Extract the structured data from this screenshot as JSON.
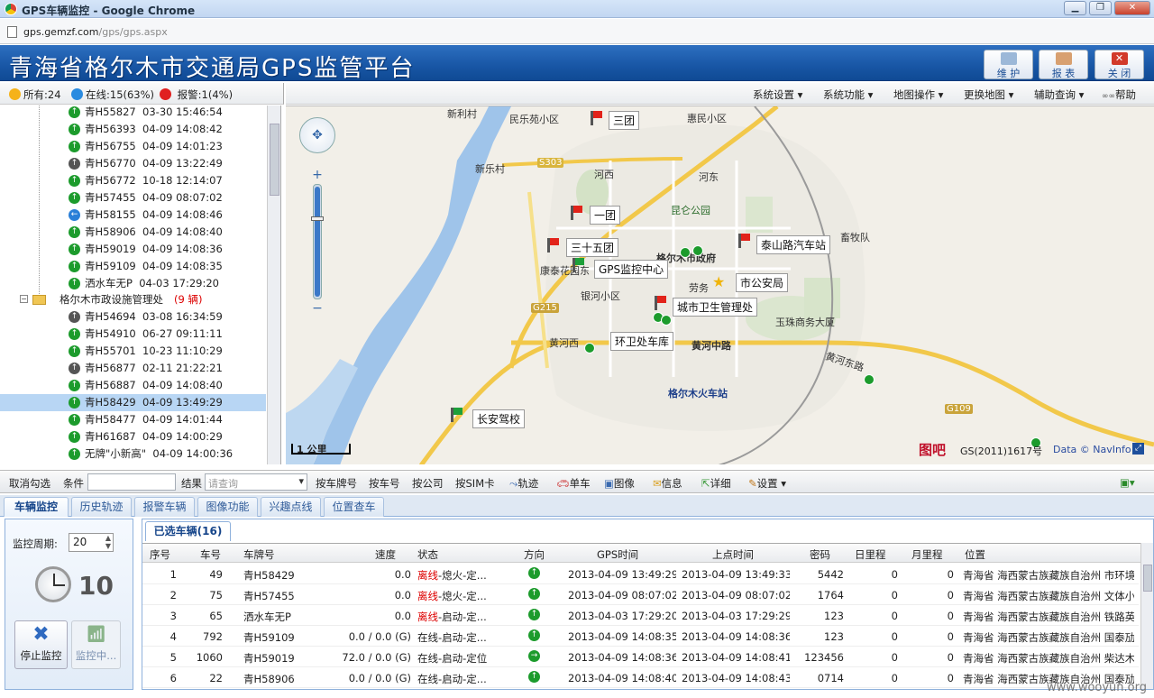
{
  "window": {
    "title": "GPS车辆监控 - Google Chrome",
    "buttons": [
      "▁",
      "❐",
      "✕"
    ]
  },
  "address": {
    "host": "gps.gemzf.com",
    "path": "/gps/gps.aspx"
  },
  "header": {
    "title": "青海省格尔木市交通局GPS监管平台",
    "buttons": [
      {
        "label": "维 护"
      },
      {
        "label": "报 表"
      },
      {
        "label": "关 闭"
      }
    ]
  },
  "status": {
    "all": "所有:24",
    "online": "在线:15(63%)",
    "alarm": "报警:1(4%)",
    "colors": {
      "all": "#f5b21a",
      "online": "#2a8be0",
      "alarm": "#e02020"
    }
  },
  "map_toolbar": [
    "系统设置 ▾",
    "系统功能 ▾",
    "地图操作 ▾",
    "更换地图 ▾",
    "辅助查询 ▾",
    "帮助"
  ],
  "tree": {
    "group_label": "格尔木市政设施管理处",
    "group_count": "(9 辆)",
    "items": [
      {
        "text": "青H55827  03-30 15:46:54",
        "icon": "green"
      },
      {
        "text": "青H56393  04-09 14:08:42",
        "icon": "green"
      },
      {
        "text": "青H56755  04-09 14:01:23",
        "icon": "green"
      },
      {
        "text": "青H56770  04-09 13:22:49",
        "icon": "gray"
      },
      {
        "text": "青H56772  10-18 12:14:07",
        "icon": "green"
      },
      {
        "text": "青H57455  04-09 08:07:02",
        "icon": "green"
      },
      {
        "text": "青H58155  04-09 14:08:46",
        "icon": "blue"
      },
      {
        "text": "青H58906  04-09 14:08:40",
        "icon": "green"
      },
      {
        "text": "青H59019  04-09 14:08:36",
        "icon": "green"
      },
      {
        "text": "青H59109  04-09 14:08:35",
        "icon": "green"
      },
      {
        "text": "洒水车无P  04-03 17:29:20",
        "icon": "green"
      }
    ],
    "group_items": [
      {
        "text": "青H54694  03-08 16:34:59",
        "icon": "gray"
      },
      {
        "text": "青H54910  06-27 09:11:11",
        "icon": "green"
      },
      {
        "text": "青H55701  10-23 11:10:29",
        "icon": "green"
      },
      {
        "text": "青H56877  02-11 21:22:21",
        "icon": "gray"
      },
      {
        "text": "青H56887  04-09 14:08:40",
        "icon": "green"
      },
      {
        "text": "青H58429  04-09 13:49:29",
        "icon": "green",
        "selected": true
      },
      {
        "text": "青H58477  04-09 14:01:44",
        "icon": "green"
      },
      {
        "text": "青H61687  04-09 14:00:29",
        "icon": "green"
      },
      {
        "text": "无牌\"小新高\"  04-09 14:00:36",
        "icon": "green"
      }
    ]
  },
  "map": {
    "places": [
      "新利村",
      "民乐苑小区",
      "惠民小区",
      "新乐村",
      "河西",
      "河东",
      "昆仑公园",
      "畜牧队",
      "格尔木市政府",
      "银河小区",
      "劳务",
      "玉珠商务大厦",
      "黄河西",
      "黄河中路",
      "黄河东路",
      "格尔木火车站",
      "康泰花园东"
    ],
    "road_labels": [
      "S303",
      "G215",
      "G109"
    ],
    "callouts": [
      "三团",
      "一团",
      "三十五团",
      "GPS监控中心",
      "泰山路汽车站",
      "市公安局",
      "城市卫生管理处",
      "环卫处车库",
      "长安驾校"
    ],
    "scale": "1 公里",
    "logo": "图吧",
    "copyright": "GS(2011)1617号",
    "data_credit": "Data © NavInfo"
  },
  "query_bar": {
    "cancel": "取消勾选",
    "condition": "条件",
    "result": "结果",
    "placeholder": "请查询",
    "buttons": [
      "按车牌号",
      "按车号",
      "按公司",
      "按SIM卡",
      "轨迹",
      "单车",
      "图像",
      "信息",
      "详细",
      "设置 ▾"
    ]
  },
  "tabs": [
    "车辆监控",
    "历史轨迹",
    "报警车辆",
    "图像功能",
    "兴趣点线",
    "位置查车"
  ],
  "monitor": {
    "period_label": "监控周期:",
    "period_value": "20",
    "countdown": "10",
    "stop": "停止监控",
    "monitoring": "监控中..."
  },
  "grid": {
    "tab": "已选车辆(16)",
    "headers": [
      "序号",
      "车号",
      "车牌号",
      "速度",
      "状态",
      "方向",
      "GPS时间",
      "上点时间",
      "密码",
      "日里程",
      "月里程",
      "位置"
    ],
    "rows": [
      {
        "no": "1",
        "num": "49",
        "plate": "青H58429",
        "speed": "0.0",
        "status_a": "离线",
        "status_b": "-熄火-定...",
        "gps": "2013-04-09 13:49:29",
        "up": "2013-04-09 13:49:33",
        "pwd": "5442",
        "day": "0",
        "month": "0",
        "loc": "青海省 海西蒙古族藏族自治州 市环境"
      },
      {
        "no": "2",
        "num": "75",
        "plate": "青H57455",
        "speed": "0.0",
        "status_a": "离线",
        "status_b": "-熄火-定...",
        "gps": "2013-04-09 08:07:02",
        "up": "2013-04-09 08:07:02",
        "pwd": "1764",
        "day": "0",
        "month": "0",
        "loc": "青海省 海西蒙古族藏族自治州 文体小"
      },
      {
        "no": "3",
        "num": "65",
        "plate": "洒水车无P",
        "speed": "0.0",
        "status_a": "离线",
        "status_b": "-启动-定...",
        "gps": "2013-04-03 17:29:20",
        "up": "2013-04-03 17:29:29",
        "pwd": "123",
        "day": "0",
        "month": "0",
        "loc": "青海省 海西蒙古族藏族自治州 铁路英"
      },
      {
        "no": "4",
        "num": "792",
        "plate": "青H59109",
        "speed": "0.0 / 0.0 (G)",
        "status_a": "",
        "status_b": "在线-启动-定...",
        "gps": "2013-04-09 14:08:35",
        "up": "2013-04-09 14:08:36",
        "pwd": "123",
        "day": "0",
        "month": "0",
        "loc": "青海省 海西蒙古族藏族自治州 国泰劢"
      },
      {
        "no": "5",
        "num": "1060",
        "plate": "青H59019",
        "speed": "72.0 / 0.0 (G)",
        "status_a": "",
        "status_b": "在线-启动-定位",
        "gps": "2013-04-09 14:08:36",
        "up": "2013-04-09 14:08:41",
        "pwd": "123456",
        "day": "0",
        "month": "0",
        "loc": "青海省 海西蒙古族藏族自治州 柴达木"
      },
      {
        "no": "6",
        "num": "22",
        "plate": "青H58906",
        "speed": "0.0 / 0.0 (G)",
        "status_a": "",
        "status_b": "在线-启动-定...",
        "gps": "2013-04-09 14:08:40",
        "up": "2013-04-09 14:08:43",
        "pwd": "0714",
        "day": "0",
        "month": "0",
        "loc": "青海省 海西蒙古族藏族自治州 国泰劢"
      }
    ]
  },
  "watermark": "www.wooyun.org"
}
